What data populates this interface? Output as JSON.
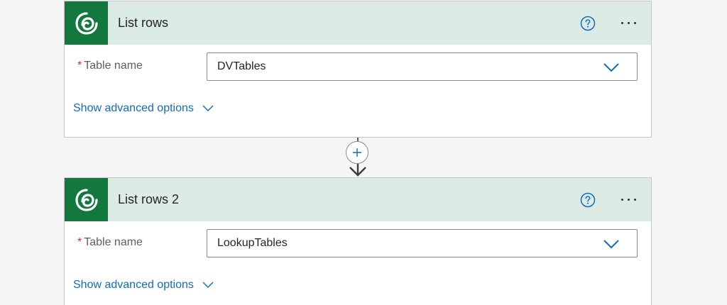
{
  "steps": [
    {
      "title": "List rows",
      "field_label": "Table name",
      "required_marker": "*",
      "selected_value": "DVTables",
      "advanced_label": "Show advanced options"
    },
    {
      "title": "List rows 2",
      "field_label": "Table name",
      "required_marker": "*",
      "selected_value": "LookupTables",
      "advanced_label": "Show advanced options"
    }
  ],
  "colors": {
    "header_bg": "#dcebe3",
    "icon_bg": "#13783d",
    "link": "#0f6cbd",
    "required": "#c4314b"
  },
  "icons": {
    "app": "dataverse-icon",
    "help": "help-circle-icon",
    "more": "more-horizontal-icon",
    "dropdown": "chevron-down-icon",
    "add": "plus-icon",
    "arrow": "arrow-down-icon"
  }
}
